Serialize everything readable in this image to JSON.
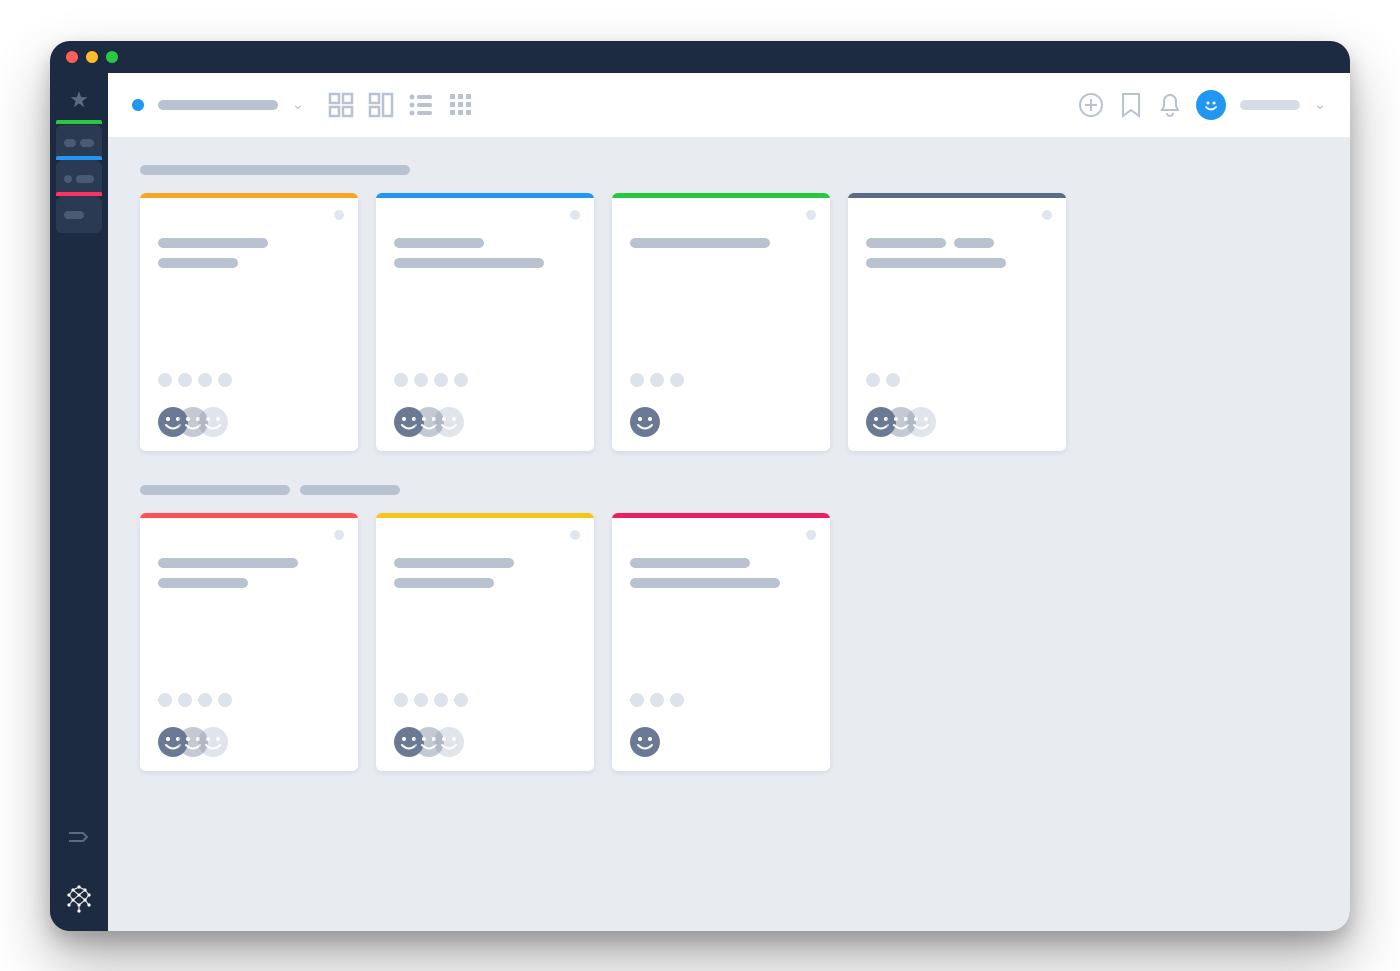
{
  "window": {
    "traffic_lights": [
      "#ff5f57",
      "#febc2e",
      "#28c840"
    ]
  },
  "sidebar": {
    "items": [
      {
        "accent": "#28c840",
        "pills": [
          12,
          14
        ]
      },
      {
        "accent": "#2196f3",
        "pills": [
          8,
          18
        ]
      },
      {
        "accent": "#ff3366",
        "pills": [
          20
        ]
      }
    ]
  },
  "topbar": {
    "view_icons": [
      "grid-large",
      "grid-kanban",
      "list",
      "grid-small"
    ],
    "right_icons": [
      "plus-circle",
      "bookmark",
      "bell"
    ]
  },
  "sections": [
    {
      "title_bars": [
        270
      ],
      "cards": [
        {
          "accent": "#f5a623",
          "title_rows": [
            [
              110
            ],
            [
              80
            ]
          ],
          "pills": 4,
          "faces": 3
        },
        {
          "accent": "#2196f3",
          "title_rows": [
            [
              90
            ],
            [
              150
            ]
          ],
          "pills": 4,
          "faces": 3
        },
        {
          "accent": "#28c840",
          "title_rows": [
            [
              140
            ]
          ],
          "pills": 3,
          "faces": 1
        },
        {
          "accent": "#5a6b85",
          "title_rows": [
            [
              80,
              40
            ],
            [
              140
            ]
          ],
          "pills": 2,
          "faces": 3
        }
      ]
    },
    {
      "title_bars": [
        150,
        100
      ],
      "cards": [
        {
          "accent": "#ff5252",
          "title_rows": [
            [
              140
            ],
            [
              90
            ]
          ],
          "pills": 4,
          "faces": 3
        },
        {
          "accent": "#f5c518",
          "title_rows": [
            [
              120
            ],
            [
              100
            ]
          ],
          "pills": 4,
          "faces": 3
        },
        {
          "accent": "#e91e63",
          "title_rows": [
            [
              120
            ],
            [
              150
            ]
          ],
          "pills": 3,
          "faces": 1
        }
      ]
    }
  ]
}
